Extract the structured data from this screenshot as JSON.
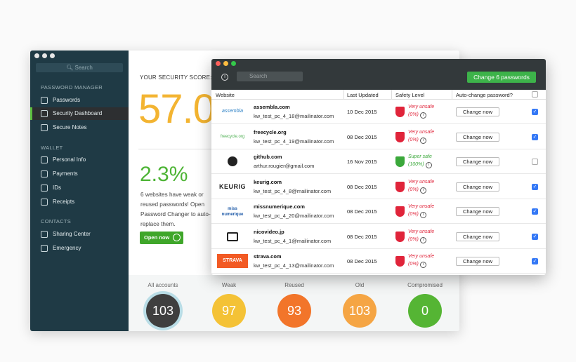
{
  "sidebar": {
    "search_placeholder": "Search",
    "sections": {
      "password_manager": "PASSWORD MANAGER",
      "wallet": "WALLET",
      "contacts": "CONTACTS"
    },
    "items": [
      {
        "label": "Passwords",
        "icon": "lock-icon"
      },
      {
        "label": "Security Dashboard",
        "icon": "shield-icon",
        "active": true
      },
      {
        "label": "Secure Notes",
        "icon": "note-icon"
      },
      {
        "label": "Personal Info",
        "icon": "person-icon"
      },
      {
        "label": "Payments",
        "icon": "card-icon"
      },
      {
        "label": "IDs",
        "icon": "id-icon"
      },
      {
        "label": "Receipts",
        "icon": "receipt-icon"
      },
      {
        "label": "Sharing Center",
        "icon": "people-icon"
      },
      {
        "label": "Emergency",
        "icon": "emergency-icon"
      }
    ]
  },
  "main": {
    "score_label": "YOUR SECURITY SCORE:",
    "score": "57.0",
    "pct": "2.3%",
    "description": "6 websites have weak or reused passwords! Open Password Changer to auto-replace them.",
    "open_now": "Open now"
  },
  "stats": [
    {
      "label": "All accounts",
      "value": "103",
      "color": "#3f3f3f"
    },
    {
      "label": "Weak",
      "value": "97",
      "color": "#f4c236"
    },
    {
      "label": "Reused",
      "value": "93",
      "color": "#f2752a"
    },
    {
      "label": "Old",
      "value": "103",
      "color": "#f5a544"
    },
    {
      "label": "Compromised",
      "value": "0",
      "color": "#55b534"
    }
  ],
  "changer": {
    "search_placeholder": "Search",
    "change_all": "Change 6 passwords",
    "headers": {
      "website": "Website",
      "updated": "Last Updated",
      "safety": "Safety Level",
      "auto": "Auto-change password?"
    },
    "change_label": "Change now",
    "rows": [
      {
        "logo": "assembla",
        "site": "assembla.com",
        "email": "kw_test_pc_4_18@mailinator.com",
        "date": "10 Dec 2015",
        "safety1": "Very unsafe",
        "safety2": "(0%)",
        "safe": false,
        "checked": true
      },
      {
        "logo": "freecycle.org",
        "site": "freecycle.org",
        "email": "kw_test_pc_4_19@mailinator.com",
        "date": "08 Dec 2015",
        "safety1": "Very unsafe",
        "safety2": "(0%)",
        "safe": false,
        "checked": true
      },
      {
        "logo": "",
        "site": "github.com",
        "email": "arthur.rougier@gmail.com",
        "date": "16 Nov 2015",
        "safety1": "Super safe",
        "safety2": "(100%)",
        "safe": true,
        "checked": false
      },
      {
        "logo": "KEURIG",
        "site": "keurig.com",
        "email": "kw_test_pc_4_8@mailinator.com",
        "date": "08 Dec 2015",
        "safety1": "Very unsafe",
        "safety2": "(0%)",
        "safe": false,
        "checked": true
      },
      {
        "logo": "miss numerique",
        "site": "missnumerique.com",
        "email": "kw_test_pc_4_20@mailinator.com",
        "date": "08 Dec 2015",
        "safety1": "Very unsafe",
        "safety2": "(0%)",
        "safe": false,
        "checked": true
      },
      {
        "logo": "",
        "site": "nicovideo.jp",
        "email": "kw_test_pc_4_1@mailinator.com",
        "date": "08 Dec 2015",
        "safety1": "Very unsafe",
        "safety2": "(0%)",
        "safe": false,
        "checked": true
      },
      {
        "logo": "STRAVA",
        "site": "strava.com",
        "email": "kw_test_pc_4_13@mailinator.com",
        "date": "08 Dec 2015",
        "safety1": "Very unsafe",
        "safety2": "(0%)",
        "safe": false,
        "checked": true
      }
    ]
  }
}
